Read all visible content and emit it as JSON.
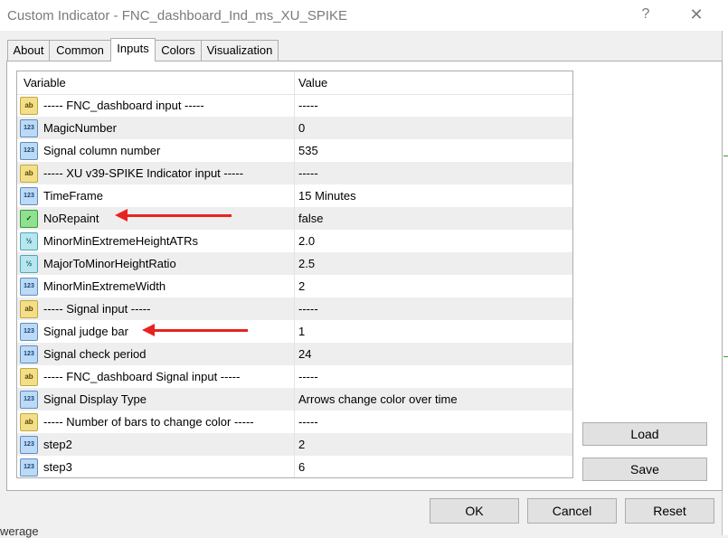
{
  "window": {
    "title": "Custom Indicator - FNC_dashboard_Ind_ms_XU_SPIKE",
    "help_glyph": "?",
    "close_glyph": "✕"
  },
  "tabs": [
    "About",
    "Common",
    "Inputs",
    "Colors",
    "Visualization"
  ],
  "active_tab": "Inputs",
  "table": {
    "headers": {
      "variable": "Variable",
      "value": "Value"
    },
    "rows": [
      {
        "type": "ab",
        "icon": "ab",
        "variable": "----- FNC_dashboard input -----",
        "value": "-----"
      },
      {
        "type": "int",
        "icon": "123",
        "variable": "MagicNumber",
        "value": "0"
      },
      {
        "type": "int",
        "icon": "123",
        "variable": "Signal column number",
        "value": "535"
      },
      {
        "type": "ab",
        "icon": "ab",
        "variable": "----- XU v39-SPIKE Indicator input -----",
        "value": "-----"
      },
      {
        "type": "int",
        "icon": "123",
        "variable": "TimeFrame",
        "value": "15 Minutes"
      },
      {
        "type": "bool",
        "icon": "✓",
        "variable": "NoRepaint",
        "value": "false"
      },
      {
        "type": "dbl",
        "icon": "½",
        "variable": "MinorMinExtremeHeightATRs",
        "value": "2.0"
      },
      {
        "type": "dbl",
        "icon": "½",
        "variable": "MajorToMinorHeightRatio",
        "value": "2.5"
      },
      {
        "type": "int",
        "icon": "123",
        "variable": "MinorMinExtremeWidth",
        "value": "2"
      },
      {
        "type": "ab",
        "icon": "ab",
        "variable": "----- Signal input -----",
        "value": "-----"
      },
      {
        "type": "int",
        "icon": "123",
        "variable": "Signal judge bar",
        "value": "1"
      },
      {
        "type": "int",
        "icon": "123",
        "variable": "Signal check period",
        "value": "24"
      },
      {
        "type": "ab",
        "icon": "ab",
        "variable": "----- FNC_dashboard Signal input -----",
        "value": "-----"
      },
      {
        "type": "int",
        "icon": "123",
        "variable": "Signal Display Type",
        "value": "Arrows change color over time"
      },
      {
        "type": "ab",
        "icon": "ab",
        "variable": "----- Number of bars to change color -----",
        "value": "-----"
      },
      {
        "type": "int",
        "icon": "123",
        "variable": "step2",
        "value": "2"
      },
      {
        "type": "int",
        "icon": "123",
        "variable": "step3",
        "value": "6"
      }
    ]
  },
  "side_buttons": {
    "load": "Load",
    "save": "Save"
  },
  "footer_buttons": {
    "ok": "OK",
    "cancel": "Cancel",
    "reset": "Reset"
  },
  "background_fragment": "werage",
  "colors": {
    "annotation_arrow": "#e8231f"
  }
}
